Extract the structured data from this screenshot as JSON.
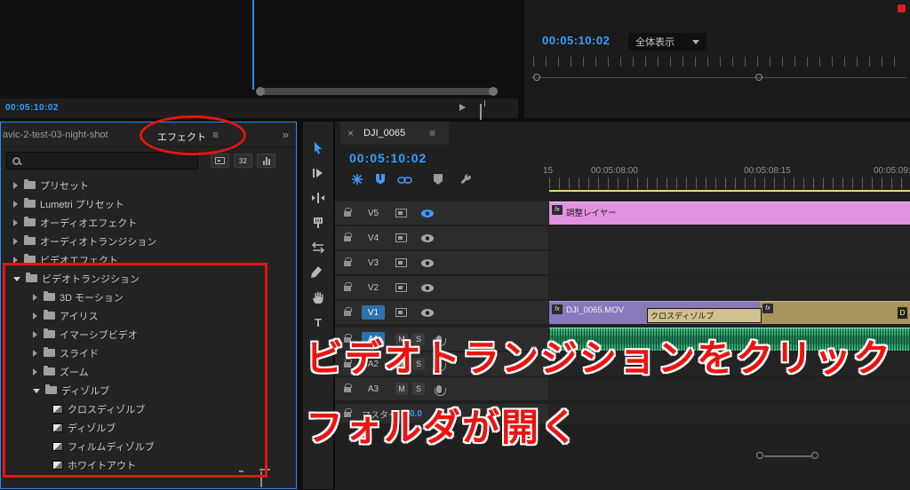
{
  "icons": {
    "menu": "≡",
    "close": "×",
    "overflow": "»",
    "fx_badge": "fx",
    "d_flag": "D",
    "bit32": "32",
    "type_tool": "T"
  },
  "source_monitor": {
    "timecode": "00:05:10:02"
  },
  "program_monitor": {
    "timecode": "00:05:10:02",
    "zoom_label": "全体表示"
  },
  "effects_panel": {
    "project_tab": "avic-2-test-03-night-shot",
    "tab": "エフェクト",
    "tree": [
      "プリセット",
      "Lumetri プリセット",
      "オーディオエフェクト",
      "オーディオトランジション",
      "ビデオエフェクト",
      "ビデオトランジション",
      "3D モーション",
      "アイリス",
      "イマーシブビデオ",
      "スライド",
      "ズーム",
      "ディゾルブ",
      "クロスディゾルブ",
      "ディゾルブ",
      "フィルムディゾルブ",
      "ホワイトアウト"
    ]
  },
  "timeline": {
    "tab": "DJI_0065",
    "timecode": "00:05:10:02",
    "ruler_labels": [
      "15",
      "00:05:08:00",
      "00:05:08:15",
      "00:05:09:0"
    ],
    "video_tracks": [
      "V5",
      "V4",
      "V3",
      "V2",
      "V1"
    ],
    "audio_tracks": [
      "A1",
      "A2",
      "A3"
    ],
    "mute_label": "M",
    "solo_label": "S",
    "master": {
      "label": "マスター",
      "value": "0.0"
    },
    "clips": {
      "adjustment_layer": "調整レイヤー",
      "video_clip": "DJI_0065.MOV",
      "transition": "クロスディゾルブ"
    }
  },
  "annotations": {
    "line1": "ビデオトランジションをクリック",
    "line2": "フォルダが開く"
  }
}
